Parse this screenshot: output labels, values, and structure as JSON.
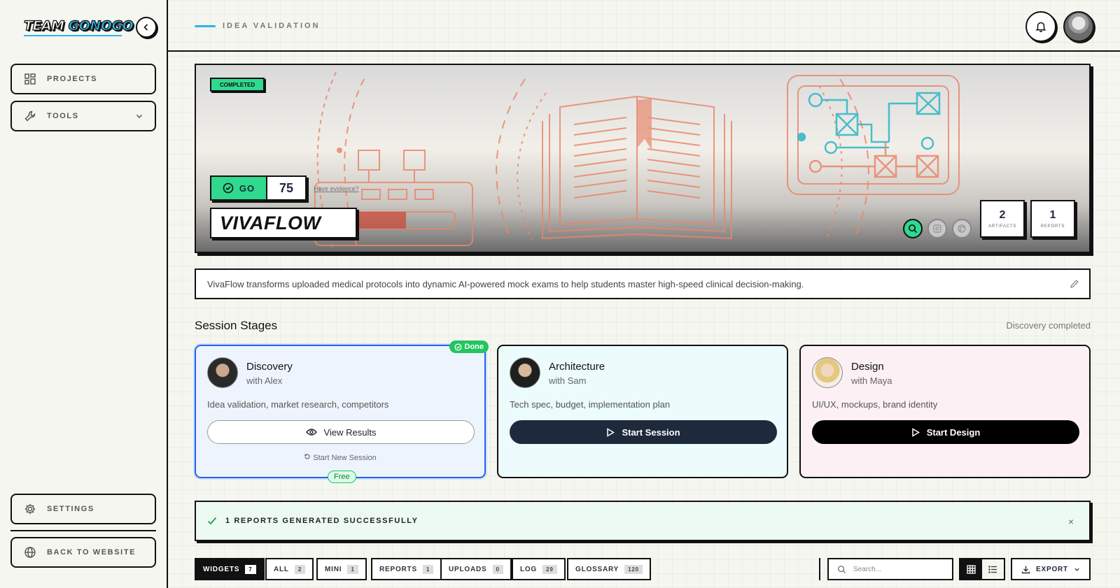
{
  "brand": {
    "part1": "TEAM ",
    "part2": "GONOGO"
  },
  "sidebar": {
    "items": [
      {
        "label": "PROJECTS",
        "icon": "grid-icon"
      },
      {
        "label": "TOOLS",
        "icon": "wrench-icon"
      }
    ],
    "bottom": [
      {
        "label": "SETTINGS",
        "icon": "gear-icon"
      },
      {
        "label": "BACK TO WEBSITE",
        "icon": "globe-icon"
      }
    ]
  },
  "header": {
    "breadcrumb": "IDEA VALIDATION"
  },
  "hero": {
    "status": "COMPLETED",
    "verdict": "GO",
    "score": "75",
    "evidence_link": "Have evidence?",
    "title": "VIVAFLOW",
    "artifacts_count": "2",
    "artifacts_label": "ARTIFACTS",
    "reports_count": "1",
    "reports_label": "REPORTS"
  },
  "description": "VivaFlow transforms uploaded medical protocols into dynamic AI-powered mock exams to help students master high-speed clinical decision-making.",
  "stages_section": {
    "title": "Session Stages",
    "status": "Discovery completed"
  },
  "stages": [
    {
      "name": "Discovery",
      "with": "with Alex",
      "desc": "Idea validation, market research, competitors",
      "button": "View Results",
      "badge": "Done",
      "restart": "Start New Session",
      "tag": "Free"
    },
    {
      "name": "Architecture",
      "with": "with Sam",
      "desc": "Tech spec, budget, implementation plan",
      "button": "Start Session"
    },
    {
      "name": "Design",
      "with": "with Maya",
      "desc": "UI/UX, mockups, brand identity",
      "button": "Start Design"
    }
  ],
  "success": {
    "message": "1 REPORTS GENERATED SUCCESSFULLY",
    "close": "×"
  },
  "tabs": [
    {
      "label": "WIDGETS",
      "count": "7"
    },
    {
      "label": "ALL",
      "count": "2"
    },
    {
      "label": "MINI",
      "count": "1"
    },
    {
      "label": "REPORTS",
      "count": "1"
    },
    {
      "label": "UPLOADS",
      "count": "0"
    },
    {
      "label": "LOG",
      "count": "29"
    },
    {
      "label": "GLOSSARY",
      "count": "120"
    }
  ],
  "search": {
    "placeholder": "Search..."
  },
  "export": {
    "label": "EXPORT"
  },
  "colors": {
    "accent_green": "#2fd98e",
    "accent_blue": "#2bb5e8",
    "dark": "#1e293b"
  }
}
